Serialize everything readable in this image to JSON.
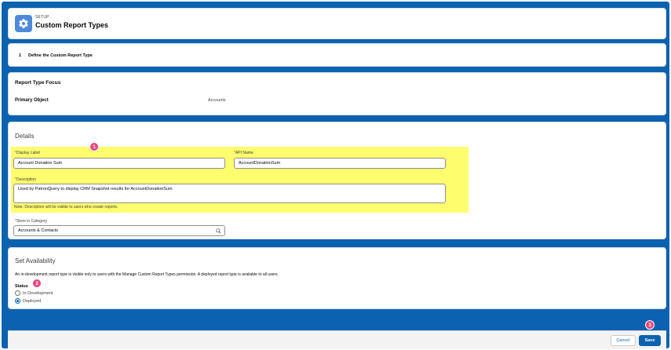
{
  "header": {
    "eyebrow": "SETUP",
    "title": "Custom Report Types",
    "icon": "gear-icon"
  },
  "step": {
    "number": "1",
    "label": "Define the Custom Report Type"
  },
  "focus": {
    "title": "Report Type Focus",
    "primary_object_label": "Primary Object",
    "primary_object_value": "Accounts"
  },
  "details": {
    "title": "Details",
    "display_label": {
      "label": "Display Label",
      "value": "Account Donation Sum"
    },
    "api_name": {
      "label": "API Name",
      "value": "AccountDonationSum"
    },
    "description": {
      "label": "Description",
      "value": "Used by PatronQuery to display CRM Snapshot results for AccountDonationSum"
    },
    "note": "Note: Description will be visible to users who create reports.",
    "category": {
      "label": "Store in Category",
      "value": "Accounts & Contacts"
    },
    "required_marker": "*"
  },
  "availability": {
    "title": "Set Availability",
    "description": "An in-development report type is visible only to users with the Manage Custom Report Types permission. A deployed report type is available to all users.",
    "status_label": "Status",
    "options": [
      {
        "label": "In Development",
        "selected": false
      },
      {
        "label": "Deployed",
        "selected": true
      }
    ]
  },
  "footer": {
    "cancel_label": "Cancel",
    "save_label": "Save"
  },
  "badges": [
    "1",
    "2",
    "3"
  ],
  "colors": {
    "brand": "#0b62b0",
    "highlight": "#fdfd6e",
    "badge": "#e9467c",
    "icon_bg": "#4f8ad9"
  }
}
